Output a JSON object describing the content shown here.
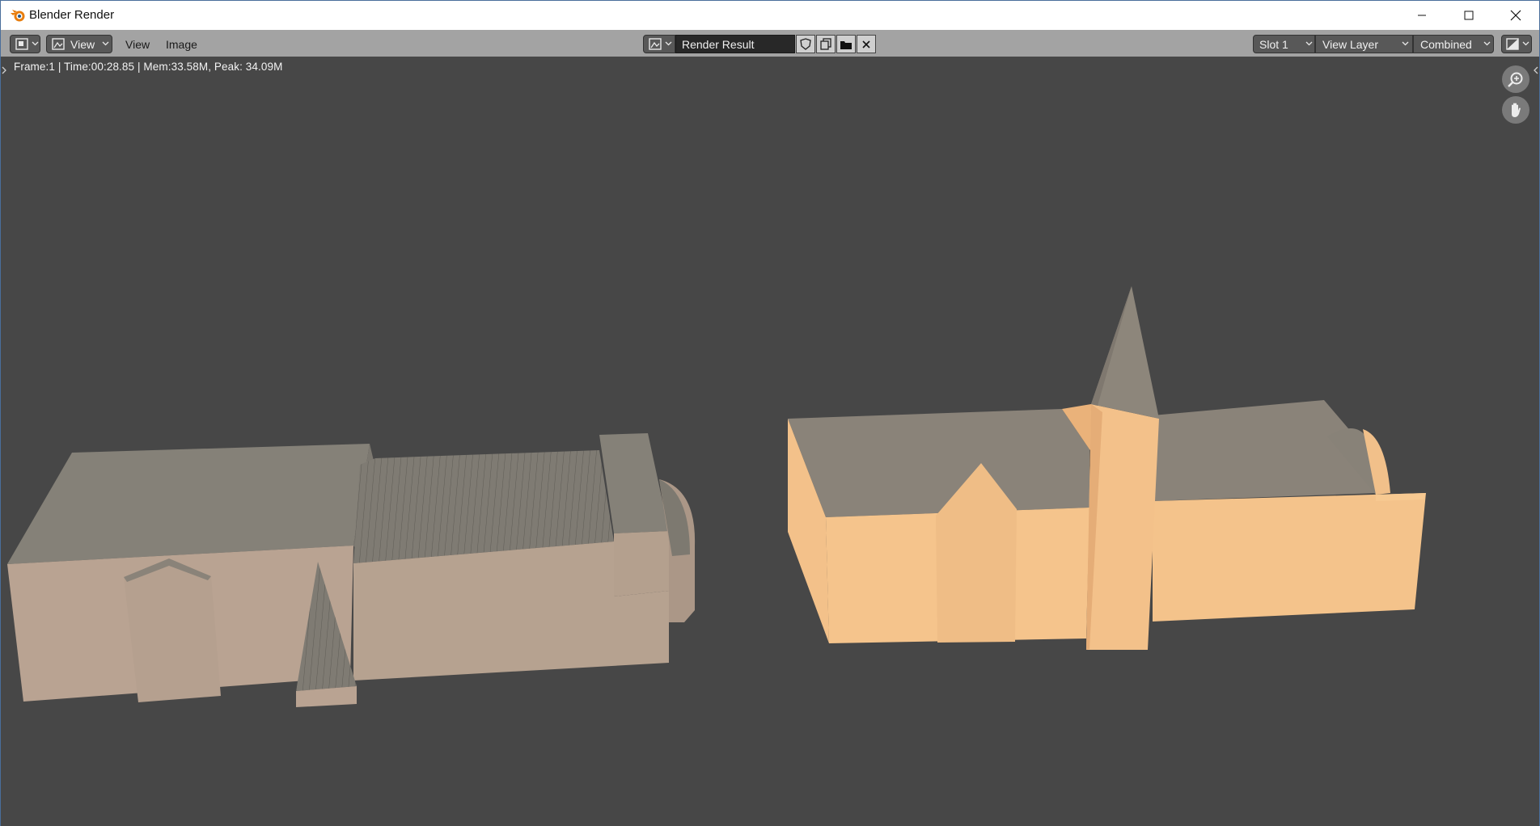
{
  "window": {
    "title": "Blender Render"
  },
  "header": {
    "menus": [
      "View",
      "Image"
    ],
    "view_dropdown_label": "View",
    "image_name": "Render Result",
    "slot": "Slot 1",
    "view_layer": "View Layer",
    "pass": "Combined"
  },
  "status": {
    "text": "Frame:1 | Time:00:28.85 | Mem:33.58M, Peak: 34.09M"
  },
  "icons": {
    "editor_type": "image-editor-icon",
    "fake_user": "shield-icon",
    "new_image": "duplicate-icon",
    "open_image": "folder-icon",
    "unlink": "close-icon",
    "zoom": "zoom-icon",
    "pan": "hand-icon"
  },
  "colors": {
    "header": "#a3a3a3",
    "viewport": "#474747",
    "building_left_wall": "#b9a392",
    "building_right_wall": "#f4c38b",
    "roof": "#878278"
  }
}
